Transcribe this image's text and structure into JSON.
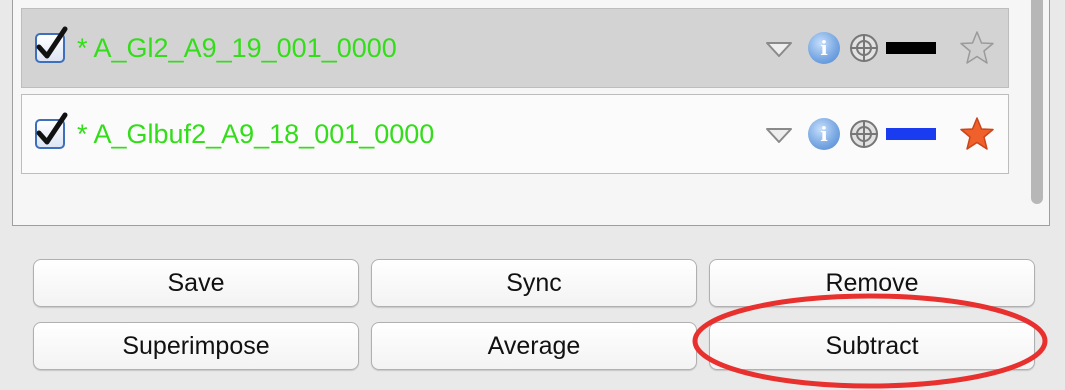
{
  "items": [
    {
      "label": "* A_Gl2_A9_19_001_0000",
      "checked": true,
      "swatch_color": "#000000",
      "star_state": "inactive",
      "star_color": "#bdbdbd"
    },
    {
      "label": "* A_Glbuf2_A9_18_001_0000",
      "checked": true,
      "swatch_color": "#1a3cf0",
      "star_state": "active",
      "star_color": "#f0602a"
    }
  ],
  "icons": {
    "dropdown": "triangle-down-icon",
    "info": "info-icon",
    "target": "crosshair-icon",
    "star": "star-icon"
  },
  "info_glyph": "i",
  "buttons": {
    "save": "Save",
    "sync": "Sync",
    "remove": "Remove",
    "superimpose": "Superimpose",
    "average": "Average",
    "subtract": "Subtract"
  },
  "highlight": {
    "target": "subtract-button",
    "color": "#e8302e"
  }
}
